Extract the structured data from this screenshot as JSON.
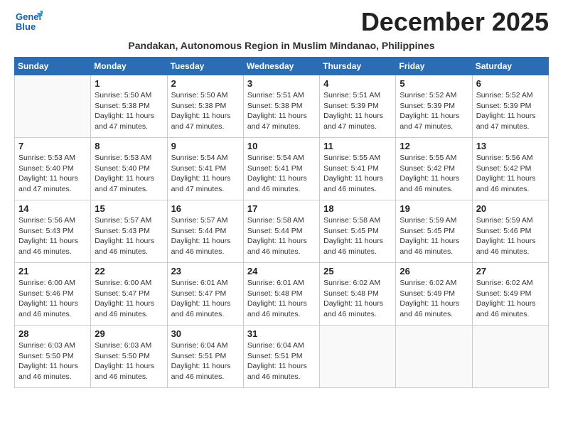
{
  "logo": {
    "line1": "General",
    "line2": "Blue"
  },
  "title": "December 2025",
  "location": "Pandakan, Autonomous Region in Muslim Mindanao, Philippines",
  "days_of_week": [
    "Sunday",
    "Monday",
    "Tuesday",
    "Wednesday",
    "Thursday",
    "Friday",
    "Saturday"
  ],
  "weeks": [
    [
      {
        "day": "",
        "sunrise": "",
        "sunset": "",
        "daylight": ""
      },
      {
        "day": "1",
        "sunrise": "Sunrise: 5:50 AM",
        "sunset": "Sunset: 5:38 PM",
        "daylight": "Daylight: 11 hours and 47 minutes."
      },
      {
        "day": "2",
        "sunrise": "Sunrise: 5:50 AM",
        "sunset": "Sunset: 5:38 PM",
        "daylight": "Daylight: 11 hours and 47 minutes."
      },
      {
        "day": "3",
        "sunrise": "Sunrise: 5:51 AM",
        "sunset": "Sunset: 5:38 PM",
        "daylight": "Daylight: 11 hours and 47 minutes."
      },
      {
        "day": "4",
        "sunrise": "Sunrise: 5:51 AM",
        "sunset": "Sunset: 5:39 PM",
        "daylight": "Daylight: 11 hours and 47 minutes."
      },
      {
        "day": "5",
        "sunrise": "Sunrise: 5:52 AM",
        "sunset": "Sunset: 5:39 PM",
        "daylight": "Daylight: 11 hours and 47 minutes."
      },
      {
        "day": "6",
        "sunrise": "Sunrise: 5:52 AM",
        "sunset": "Sunset: 5:39 PM",
        "daylight": "Daylight: 11 hours and 47 minutes."
      }
    ],
    [
      {
        "day": "7",
        "sunrise": "Sunrise: 5:53 AM",
        "sunset": "Sunset: 5:40 PM",
        "daylight": "Daylight: 11 hours and 47 minutes."
      },
      {
        "day": "8",
        "sunrise": "Sunrise: 5:53 AM",
        "sunset": "Sunset: 5:40 PM",
        "daylight": "Daylight: 11 hours and 47 minutes."
      },
      {
        "day": "9",
        "sunrise": "Sunrise: 5:54 AM",
        "sunset": "Sunset: 5:41 PM",
        "daylight": "Daylight: 11 hours and 47 minutes."
      },
      {
        "day": "10",
        "sunrise": "Sunrise: 5:54 AM",
        "sunset": "Sunset: 5:41 PM",
        "daylight": "Daylight: 11 hours and 46 minutes."
      },
      {
        "day": "11",
        "sunrise": "Sunrise: 5:55 AM",
        "sunset": "Sunset: 5:41 PM",
        "daylight": "Daylight: 11 hours and 46 minutes."
      },
      {
        "day": "12",
        "sunrise": "Sunrise: 5:55 AM",
        "sunset": "Sunset: 5:42 PM",
        "daylight": "Daylight: 11 hours and 46 minutes."
      },
      {
        "day": "13",
        "sunrise": "Sunrise: 5:56 AM",
        "sunset": "Sunset: 5:42 PM",
        "daylight": "Daylight: 11 hours and 46 minutes."
      }
    ],
    [
      {
        "day": "14",
        "sunrise": "Sunrise: 5:56 AM",
        "sunset": "Sunset: 5:43 PM",
        "daylight": "Daylight: 11 hours and 46 minutes."
      },
      {
        "day": "15",
        "sunrise": "Sunrise: 5:57 AM",
        "sunset": "Sunset: 5:43 PM",
        "daylight": "Daylight: 11 hours and 46 minutes."
      },
      {
        "day": "16",
        "sunrise": "Sunrise: 5:57 AM",
        "sunset": "Sunset: 5:44 PM",
        "daylight": "Daylight: 11 hours and 46 minutes."
      },
      {
        "day": "17",
        "sunrise": "Sunrise: 5:58 AM",
        "sunset": "Sunset: 5:44 PM",
        "daylight": "Daylight: 11 hours and 46 minutes."
      },
      {
        "day": "18",
        "sunrise": "Sunrise: 5:58 AM",
        "sunset": "Sunset: 5:45 PM",
        "daylight": "Daylight: 11 hours and 46 minutes."
      },
      {
        "day": "19",
        "sunrise": "Sunrise: 5:59 AM",
        "sunset": "Sunset: 5:45 PM",
        "daylight": "Daylight: 11 hours and 46 minutes."
      },
      {
        "day": "20",
        "sunrise": "Sunrise: 5:59 AM",
        "sunset": "Sunset: 5:46 PM",
        "daylight": "Daylight: 11 hours and 46 minutes."
      }
    ],
    [
      {
        "day": "21",
        "sunrise": "Sunrise: 6:00 AM",
        "sunset": "Sunset: 5:46 PM",
        "daylight": "Daylight: 11 hours and 46 minutes."
      },
      {
        "day": "22",
        "sunrise": "Sunrise: 6:00 AM",
        "sunset": "Sunset: 5:47 PM",
        "daylight": "Daylight: 11 hours and 46 minutes."
      },
      {
        "day": "23",
        "sunrise": "Sunrise: 6:01 AM",
        "sunset": "Sunset: 5:47 PM",
        "daylight": "Daylight: 11 hours and 46 minutes."
      },
      {
        "day": "24",
        "sunrise": "Sunrise: 6:01 AM",
        "sunset": "Sunset: 5:48 PM",
        "daylight": "Daylight: 11 hours and 46 minutes."
      },
      {
        "day": "25",
        "sunrise": "Sunrise: 6:02 AM",
        "sunset": "Sunset: 5:48 PM",
        "daylight": "Daylight: 11 hours and 46 minutes."
      },
      {
        "day": "26",
        "sunrise": "Sunrise: 6:02 AM",
        "sunset": "Sunset: 5:49 PM",
        "daylight": "Daylight: 11 hours and 46 minutes."
      },
      {
        "day": "27",
        "sunrise": "Sunrise: 6:02 AM",
        "sunset": "Sunset: 5:49 PM",
        "daylight": "Daylight: 11 hours and 46 minutes."
      }
    ],
    [
      {
        "day": "28",
        "sunrise": "Sunrise: 6:03 AM",
        "sunset": "Sunset: 5:50 PM",
        "daylight": "Daylight: 11 hours and 46 minutes."
      },
      {
        "day": "29",
        "sunrise": "Sunrise: 6:03 AM",
        "sunset": "Sunset: 5:50 PM",
        "daylight": "Daylight: 11 hours and 46 minutes."
      },
      {
        "day": "30",
        "sunrise": "Sunrise: 6:04 AM",
        "sunset": "Sunset: 5:51 PM",
        "daylight": "Daylight: 11 hours and 46 minutes."
      },
      {
        "day": "31",
        "sunrise": "Sunrise: 6:04 AM",
        "sunset": "Sunset: 5:51 PM",
        "daylight": "Daylight: 11 hours and 46 minutes."
      },
      {
        "day": "",
        "sunrise": "",
        "sunset": "",
        "daylight": ""
      },
      {
        "day": "",
        "sunrise": "",
        "sunset": "",
        "daylight": ""
      },
      {
        "day": "",
        "sunrise": "",
        "sunset": "",
        "daylight": ""
      }
    ]
  ]
}
